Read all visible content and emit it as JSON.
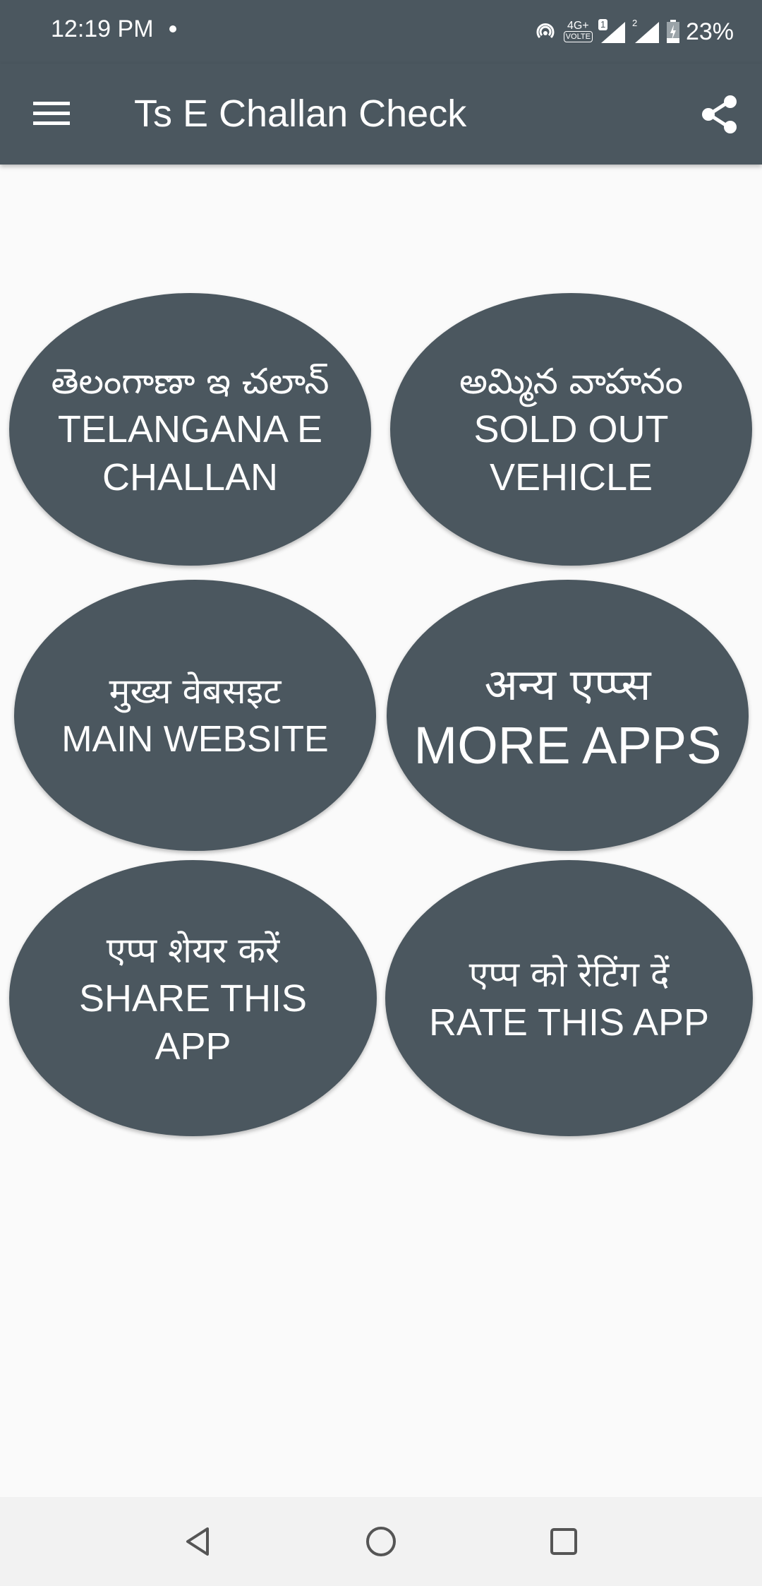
{
  "status_bar": {
    "time": "12:19 PM",
    "network": "4G+",
    "volte": "VOLTE",
    "sim1": "1",
    "sim2": "2",
    "battery": "23%"
  },
  "app_bar": {
    "title": "Ts E Challan Check",
    "menu_icon": "hamburger-menu-icon",
    "share_icon": "share-icon"
  },
  "buttons": [
    {
      "lines": [
        "తెలంగాణా ఇ చలాన్",
        "TELANGANA E",
        "CHALLAN"
      ]
    },
    {
      "lines": [
        "అమ్మిన వాహనం",
        "SOLD OUT",
        "VEHICLE"
      ]
    },
    {
      "lines": [
        "मुख्य वेबसइट",
        "MAIN WEBSITE"
      ]
    },
    {
      "lines": [
        "अन्य एप्प्स",
        "MORE APPS"
      ]
    },
    {
      "lines": [
        "एप्प शेयर करें",
        "SHARE THIS",
        "APP"
      ]
    },
    {
      "lines": [
        "एप्प को रेटिंग दें",
        "RATE THIS APP"
      ]
    }
  ],
  "nav_bar": {
    "back_icon": "back-triangle-icon",
    "home_icon": "home-circle-icon",
    "recents_icon": "recents-square-icon"
  },
  "colors": {
    "primary": "#4b575f",
    "background": "#fafafa",
    "text_on_primary": "#ffffff"
  }
}
